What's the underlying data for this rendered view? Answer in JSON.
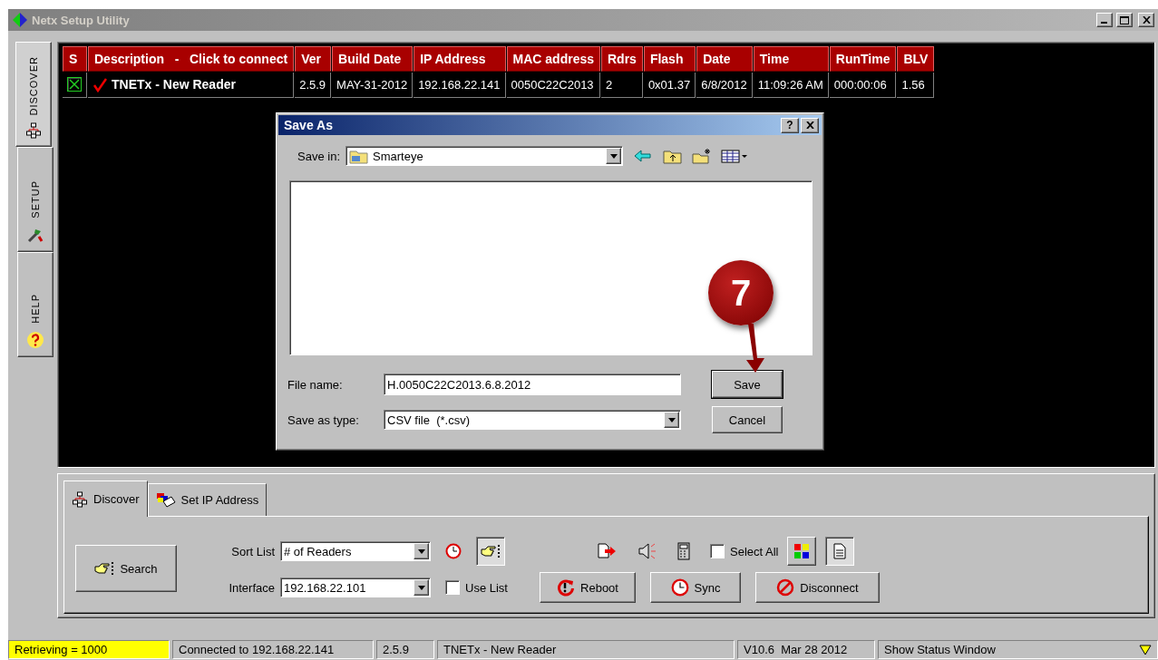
{
  "window": {
    "title": "Netx Setup Utility"
  },
  "side_tabs": [
    {
      "label": "DISCOVER",
      "selected": true,
      "kind": "discover"
    },
    {
      "label": "SETUP",
      "selected": false,
      "kind": "setup"
    },
    {
      "label": "HELP",
      "selected": false,
      "kind": "help"
    }
  ],
  "table": {
    "columns": [
      "S",
      "Description   -   Click to connect",
      "Ver",
      "Build Date",
      "IP Address",
      "MAC address",
      "Rdrs",
      "Flash",
      "Date",
      "Time",
      "RunTime",
      "BLV"
    ],
    "rows": [
      {
        "checked": true,
        "connected": true,
        "cells": [
          "",
          "TNETx - New Reader",
          "2.5.9",
          "MAY-31-2012",
          "192.168.22.141",
          "0050C22C2013",
          "2",
          "0x01.37",
          "6/8/2012",
          "11:09:26 AM",
          "000:00:06",
          "1.56"
        ]
      }
    ]
  },
  "dialog": {
    "title": "Save As",
    "help_button": "?",
    "save_in": {
      "label": "Save in:",
      "value": "Smarteye"
    },
    "file_name": {
      "label": "File name:",
      "value": "H.0050C22C2013.6.8.2012"
    },
    "save_as_type": {
      "label": "Save as type:",
      "value": "CSV file  (*.csv)"
    },
    "buttons": [
      "Save",
      "Cancel"
    ]
  },
  "callout": {
    "label": "7"
  },
  "panel": {
    "tabs": [
      {
        "label": "Discover",
        "selected": true,
        "kind": "discover"
      },
      {
        "label": "Set IP Address",
        "selected": false,
        "kind": "ip"
      }
    ],
    "search_button": "Search",
    "sort_list": {
      "label": "Sort List",
      "value": "# of Readers"
    },
    "interface": {
      "label": "Interface",
      "value": "192.168.22.101"
    },
    "pointer_toggle": {
      "on": true
    },
    "use_list": {
      "label": "Use List",
      "checked": false
    },
    "select_all": {
      "label": "Select All",
      "checked": false
    },
    "view_toggles": [
      {
        "kind": "colors",
        "on": false
      },
      {
        "kind": "page",
        "on": true
      }
    ],
    "buttons": [
      {
        "label": "Reboot",
        "kind": "reboot"
      },
      {
        "label": "Sync",
        "kind": "sync"
      },
      {
        "label": "Disconnect",
        "kind": "disconnect"
      }
    ]
  },
  "status_bar": [
    {
      "text": "Retrieving = 1000",
      "highlighted": true
    },
    {
      "text": "Connected to 192.168.22.141",
      "highlighted": false
    },
    {
      "text": "2.5.9",
      "highlighted": false
    },
    {
      "text": "TNETx - New Reader",
      "highlighted": false
    },
    {
      "text": "V10.6  Mar 28 2012",
      "highlighted": false
    },
    {
      "text": "Show Status Window",
      "highlighted": false
    }
  ]
}
